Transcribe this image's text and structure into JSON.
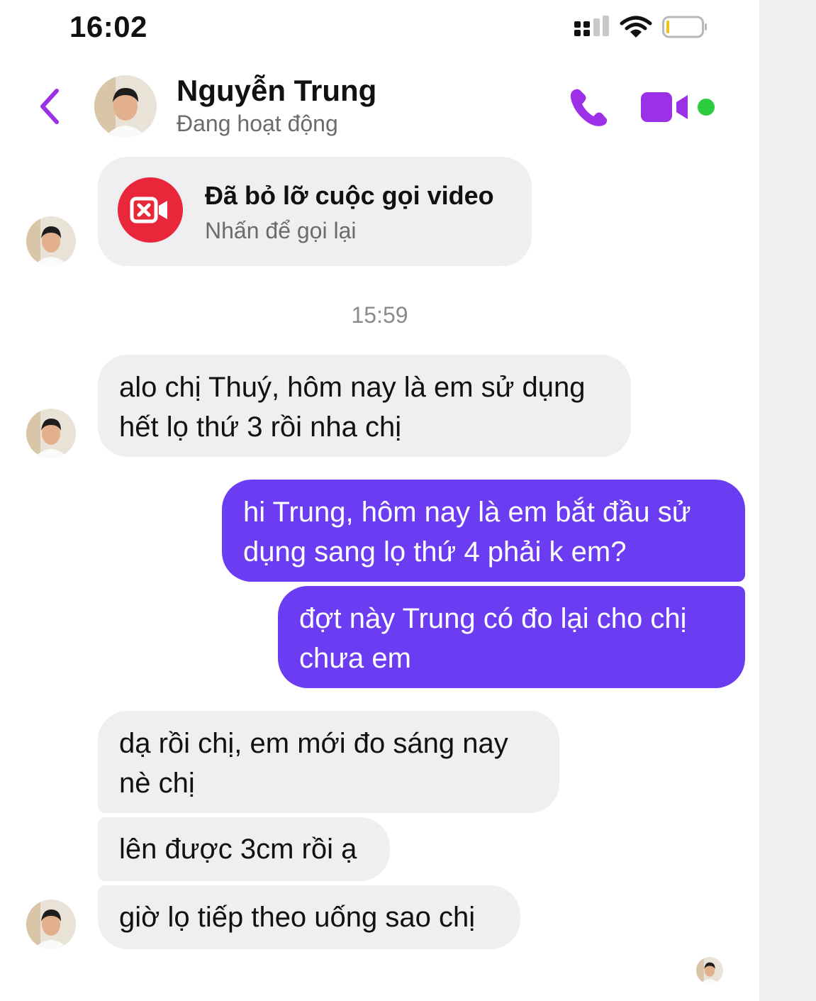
{
  "status_bar": {
    "time": "16:02"
  },
  "header": {
    "contact_name": "Nguyễn Trung",
    "contact_status": "Đang hoạt động"
  },
  "missed_call": {
    "title": "Đã bỏ lỡ cuộc gọi video",
    "subtitle": "Nhấn để gọi lại"
  },
  "timestamp": "15:59",
  "messages": [
    {
      "direction": "incoming",
      "text": "alo chị Thuý, hôm nay là em sử dụng\nhết lọ thứ 3 rồi nha chị"
    },
    {
      "direction": "outgoing",
      "text": "hi Trung, hôm nay là em bắt đầu sử\ndụng sang lọ thứ 4 phải k em?"
    },
    {
      "direction": "outgoing",
      "text": "đợt này Trung có đo lại cho chị\nchưa em"
    },
    {
      "direction": "incoming",
      "text": "dạ rồi chị, em mới đo sáng nay\nnè chị"
    },
    {
      "direction": "incoming",
      "text": "lên được 3cm rồi ạ"
    },
    {
      "direction": "incoming",
      "text": "giờ lọ tiếp theo uống sao chị"
    }
  ],
  "colors": {
    "accent": "#6b3cf2",
    "icon_purple": "#9b30e6",
    "missed_red": "#e8283a",
    "active_green": "#2ecc40",
    "incoming_bubble": "#efeff1"
  },
  "icons": [
    "signal-icon",
    "wifi-icon",
    "battery-icon",
    "back-icon",
    "phone-icon",
    "video-camera-icon",
    "missed-video-icon",
    "seen-avatar"
  ]
}
